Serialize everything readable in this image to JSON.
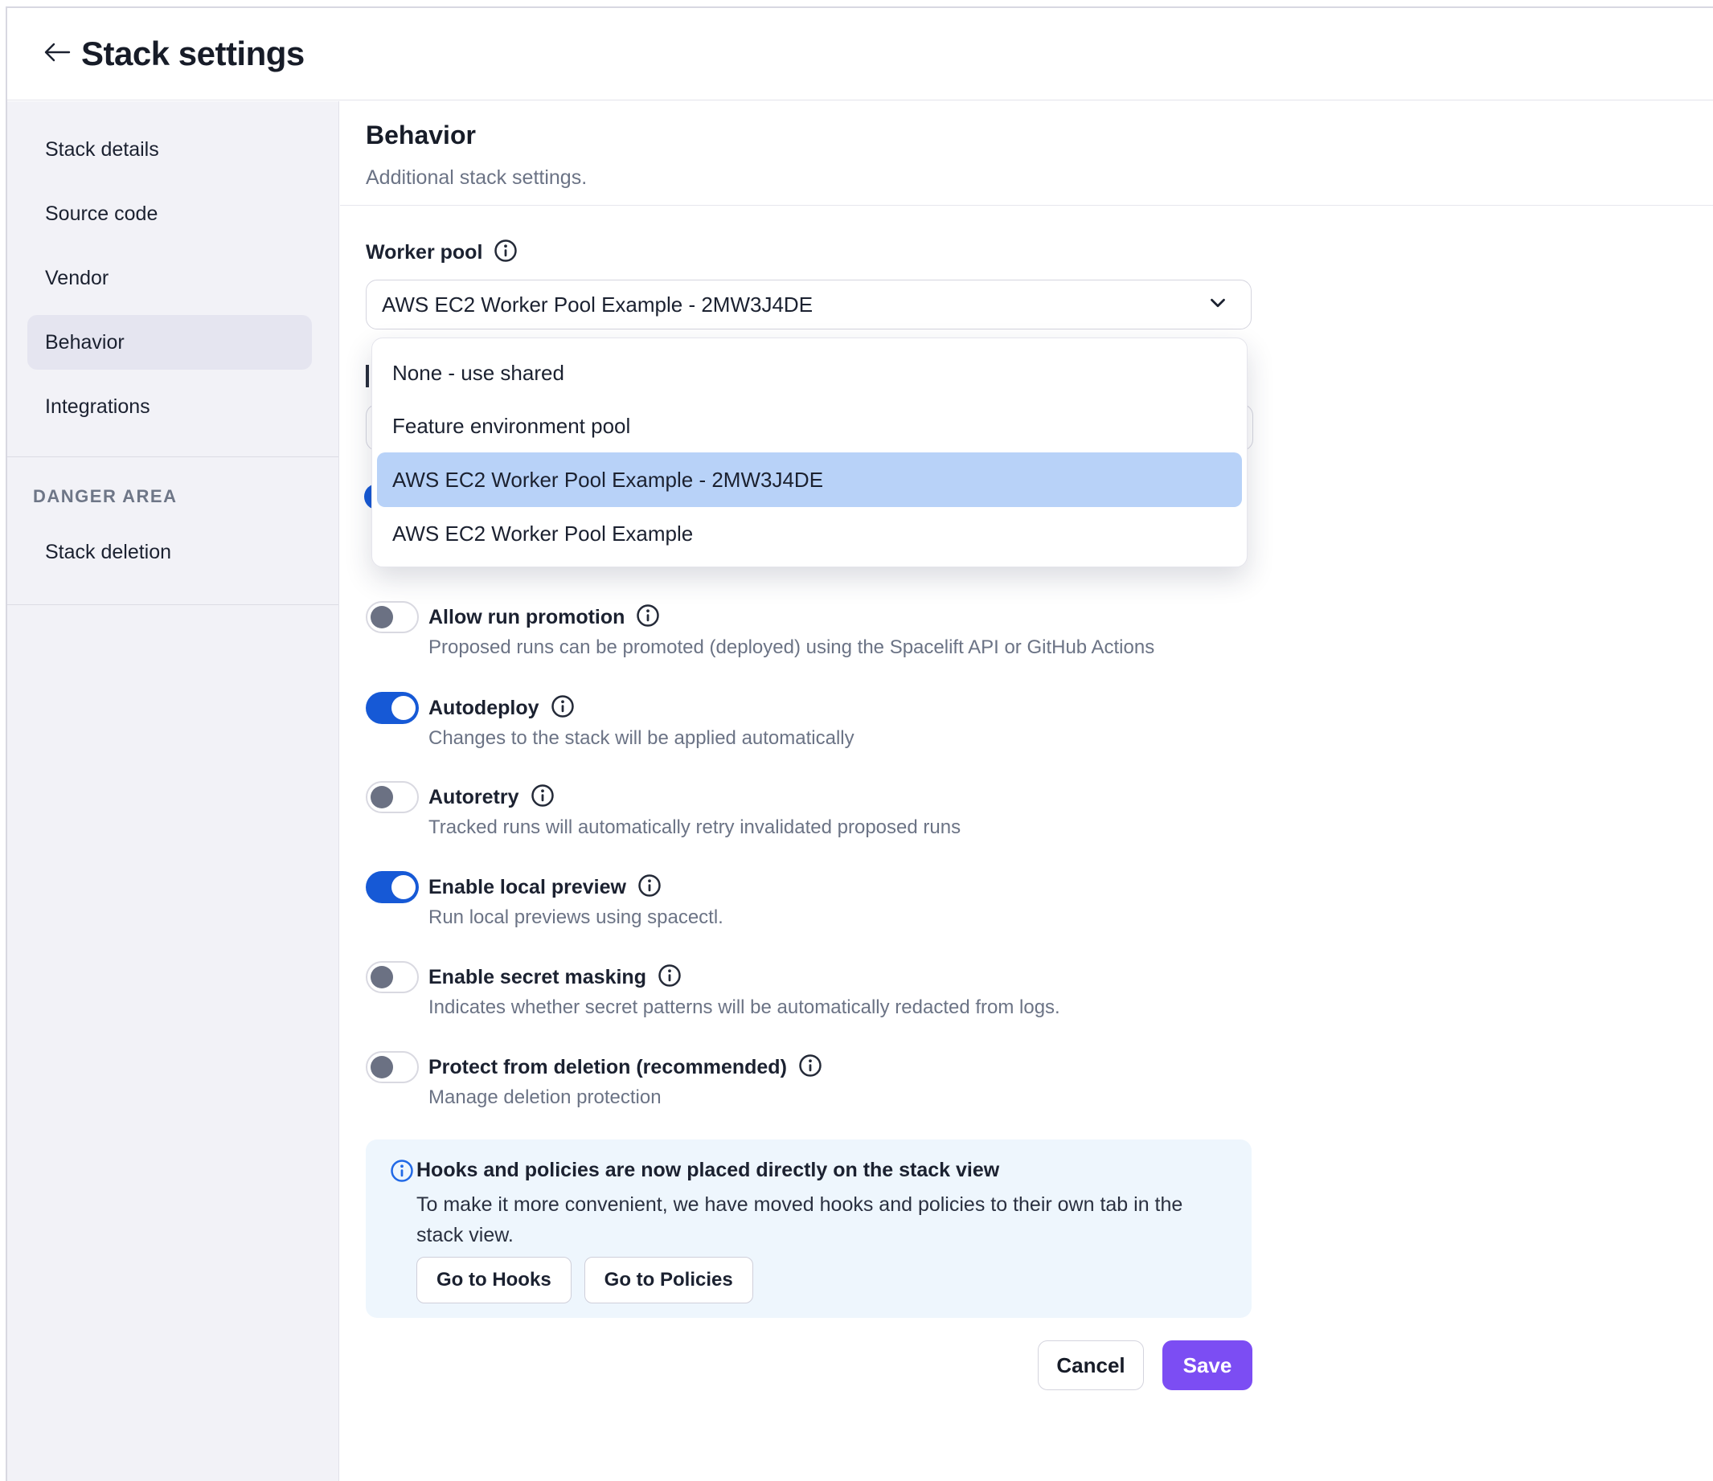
{
  "header": {
    "title": "Stack settings"
  },
  "sidebar": {
    "items": [
      {
        "label": "Stack details",
        "selected": false
      },
      {
        "label": "Source code",
        "selected": false
      },
      {
        "label": "Vendor",
        "selected": false
      },
      {
        "label": "Behavior",
        "selected": true
      },
      {
        "label": "Integrations",
        "selected": false
      }
    ],
    "danger": {
      "section_label": "DANGER AREA",
      "item": "Stack deletion"
    }
  },
  "main": {
    "title": "Behavior",
    "subtitle": "Additional stack settings.",
    "worker_pool": {
      "label": "Worker pool",
      "selected_value": "AWS EC2 Worker Pool Example - 2MW3J4DE",
      "options": [
        "None - use shared",
        "Feature environment pool",
        "AWS EC2 Worker Pool Example - 2MW3J4DE",
        "AWS EC2 Worker Pool Example"
      ],
      "highlighted_option": "AWS EC2 Worker Pool Example - 2MW3J4DE"
    },
    "toggles": [
      {
        "label": "Allow run promotion",
        "on": false,
        "description": "Proposed runs can be promoted (deployed) using the Spacelift API or GitHub Actions"
      },
      {
        "label": "Autodeploy",
        "on": true,
        "description": "Changes to the stack will be applied automatically"
      },
      {
        "label": "Autoretry",
        "on": false,
        "description": "Tracked runs will automatically retry invalidated proposed runs"
      },
      {
        "label": "Enable local preview",
        "on": true,
        "description": "Run local previews using spacectl."
      },
      {
        "label": "Enable secret masking",
        "on": false,
        "description": "Indicates whether secret patterns will be automatically redacted from logs."
      },
      {
        "label": "Protect from deletion (recommended)",
        "on": false,
        "description": "Manage deletion protection"
      }
    ],
    "info_box": {
      "title": "Hooks and policies are now placed directly on the stack view",
      "body": "To make it more convenient, we have moved hooks and policies to their own tab in the stack view.",
      "buttons": {
        "hooks": "Go to Hooks",
        "policies": "Go to Policies"
      }
    },
    "actions": {
      "cancel": "Cancel",
      "save": "Save"
    }
  },
  "colors": {
    "toggle_on": "#1659d6",
    "toggle_knob_off": "#6b7183",
    "dropdown_highlight": "#b8d2f8",
    "save_button": "#7c4df3",
    "info_box_bg": "#eef6fd",
    "info_icon_blue": "#2169e6",
    "sidebar_bg": "#f2f2f7",
    "sidebar_selected_bg": "#e5e5f0"
  }
}
